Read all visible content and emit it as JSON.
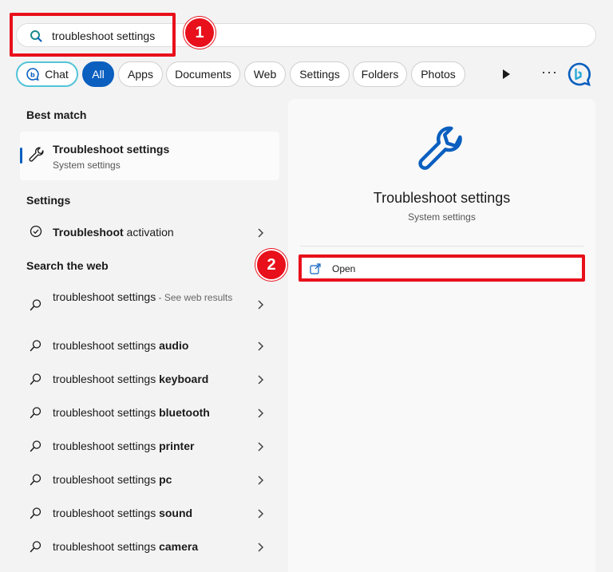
{
  "search": {
    "query": "troubleshoot settings"
  },
  "callouts": [
    "1",
    "2"
  ],
  "filters": {
    "items": [
      "Chat",
      "All",
      "Apps",
      "Documents",
      "Web",
      "Settings",
      "Folders",
      "Photos"
    ],
    "more": "···"
  },
  "left": {
    "best_match_title": "Best match",
    "best_match": {
      "title": "Troubleshoot settings",
      "subtitle": "System settings"
    },
    "settings_title": "Settings",
    "settings_item": {
      "bold": "Troubleshoot",
      "rest": " activation"
    },
    "web_title": "Search the web",
    "web_first": {
      "query": "troubleshoot settings",
      "suffix": " - See web results"
    },
    "web_prefix": "troubleshoot settings ",
    "web_items": [
      "audio",
      "keyboard",
      "bluetooth",
      "printer",
      "pc",
      "sound",
      "camera"
    ]
  },
  "preview": {
    "title": "Troubleshoot settings",
    "subtitle": "System settings",
    "open_label": "Open"
  },
  "colors": {
    "accent": "#0a5fbf",
    "callout": "#e8101b",
    "chat_ring": "#52c4d8"
  }
}
